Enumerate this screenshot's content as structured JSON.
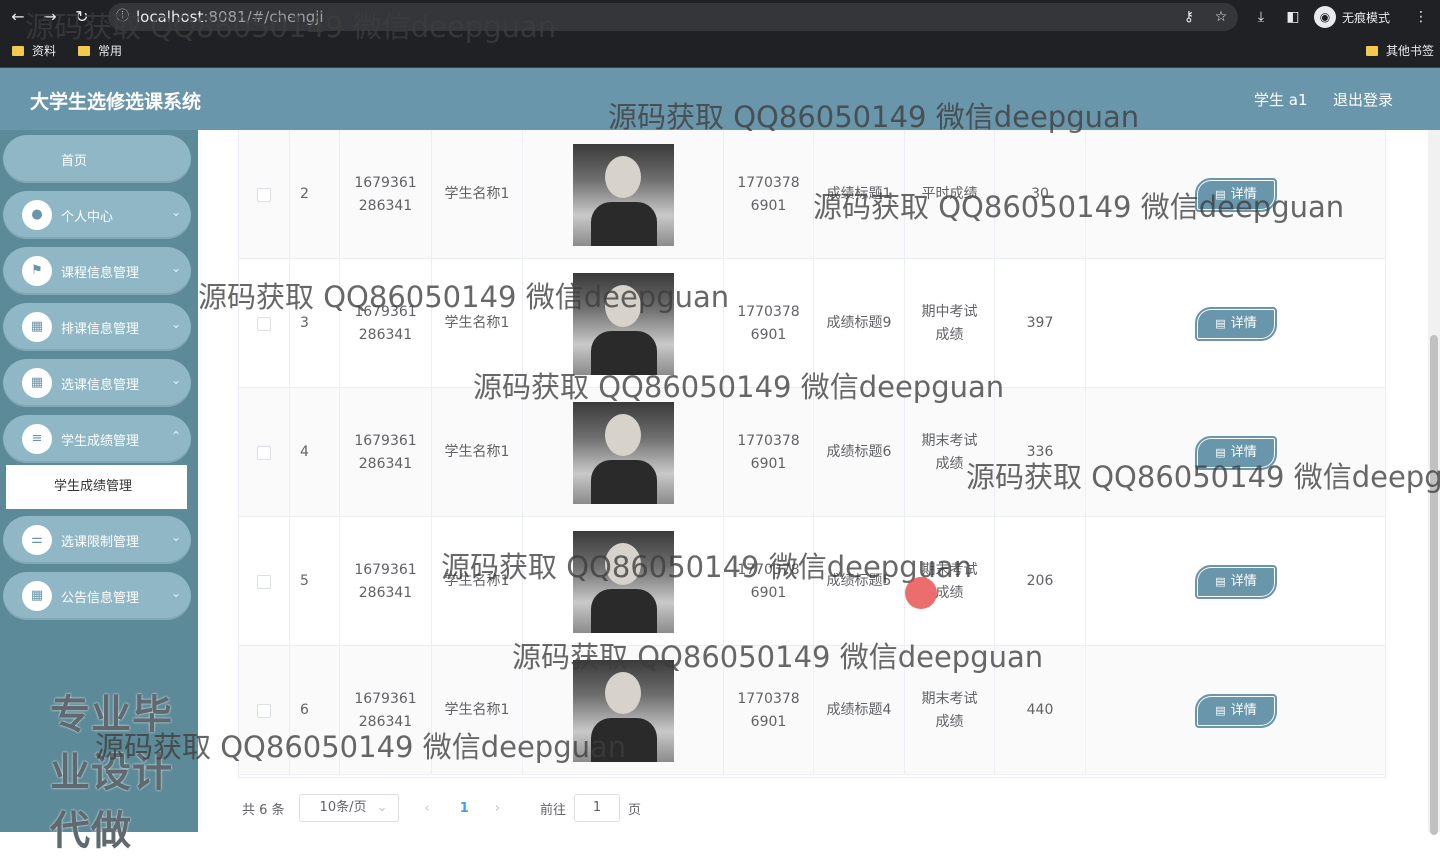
{
  "browser": {
    "url_host": "localhost",
    "url_path": ":8081/#/chengji",
    "incognito_label": "无痕模式",
    "bookmarks": [
      "资料",
      "常用"
    ],
    "other_bookmarks": "其他书签"
  },
  "header": {
    "title": "大学生选修选课系统",
    "user": "学生 a1",
    "logout": "退出登录"
  },
  "sidebar": {
    "items": [
      {
        "label": "首页",
        "icon": "home-icon"
      },
      {
        "label": "个人中心",
        "icon": "user-icon"
      },
      {
        "label": "课程信息管理",
        "icon": "flag-icon"
      },
      {
        "label": "排课信息管理",
        "icon": "grid-icon"
      },
      {
        "label": "选课信息管理",
        "icon": "grid-icon"
      },
      {
        "label": "学生成绩管理",
        "icon": "list-icon"
      },
      {
        "label": "选课限制管理",
        "icon": "sliders-icon"
      },
      {
        "label": "公告信息管理",
        "icon": "grid-icon"
      }
    ],
    "submenu_label": "学生成绩管理",
    "slogan": "专业毕业设计代做"
  },
  "table": {
    "rows": [
      {
        "index": "2",
        "student_no": "1679361286341",
        "student_name": "学生名称1",
        "phone": "17703786901",
        "title": "成绩标题1",
        "type": "平时成绩",
        "score": "30"
      },
      {
        "index": "3",
        "student_no": "1679361286341",
        "student_name": "学生名称1",
        "phone": "17703786901",
        "title": "成绩标题9",
        "type": "期中考试成绩",
        "score": "397"
      },
      {
        "index": "4",
        "student_no": "1679361286341",
        "student_name": "学生名称1",
        "phone": "17703786901",
        "title": "成绩标题6",
        "type": "期末考试成绩",
        "score": "336"
      },
      {
        "index": "5",
        "student_no": "1679361286341",
        "student_name": "学生名称1",
        "phone": "17703786901",
        "title": "成绩标题5",
        "type": "期末考试成绩",
        "score": "206"
      },
      {
        "index": "6",
        "student_no": "1679361286341",
        "student_name": "学生名称1",
        "phone": "17703786901",
        "title": "成绩标题4",
        "type": "期末考试成绩",
        "score": "440"
      }
    ],
    "detail_label": "详情"
  },
  "pagination": {
    "total": "共 6 条",
    "page_size": "10条/页",
    "current_page": "1",
    "goto_label": "前往",
    "goto_value": "1",
    "page_suffix": "页"
  },
  "watermark": "源码获取 QQ86050149 微信deepguan"
}
